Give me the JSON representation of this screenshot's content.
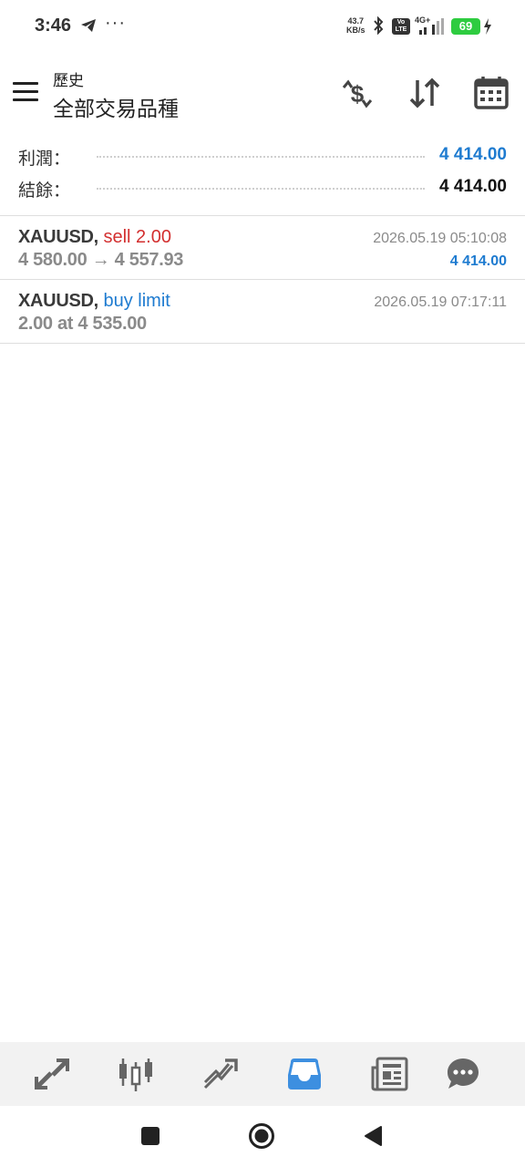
{
  "status_bar": {
    "time": "3:46",
    "more": "···",
    "speed_value": "43.7",
    "speed_unit": "KB/s",
    "volte_top": "Vo",
    "volte_bottom": "LTE",
    "network": "4G+",
    "battery": "69"
  },
  "header": {
    "subtitle": "歷史",
    "title": "全部交易品種"
  },
  "summary": {
    "profit_label": "利潤：",
    "profit_value": "4 414.00",
    "balance_label": "結餘：",
    "balance_value": "4 414.00"
  },
  "trades": [
    {
      "symbol": "XAUUSD,",
      "action": "sell 2.00",
      "detail": "4 580.00 → 4 557.93",
      "time": "2026.05.19 05:10:08",
      "profit": "4 414.00"
    },
    {
      "symbol": "XAUUSD,",
      "action": "buy limit",
      "detail": "2.00 at 4 535.00",
      "time": "2026.05.19 07:17:11"
    }
  ],
  "colors": {
    "sell": "#d32f2f",
    "buy": "#1e7bd0",
    "profit_positive": "#1e7bd0",
    "nav_active": "#3d8fe0",
    "nav_inactive": "#666666"
  },
  "bottom_nav": [
    "quotes-icon",
    "chart-icon",
    "trade-icon",
    "history-icon",
    "news-icon",
    "chat-icon"
  ],
  "system_nav": [
    "recents-icon",
    "home-icon",
    "back-icon"
  ]
}
